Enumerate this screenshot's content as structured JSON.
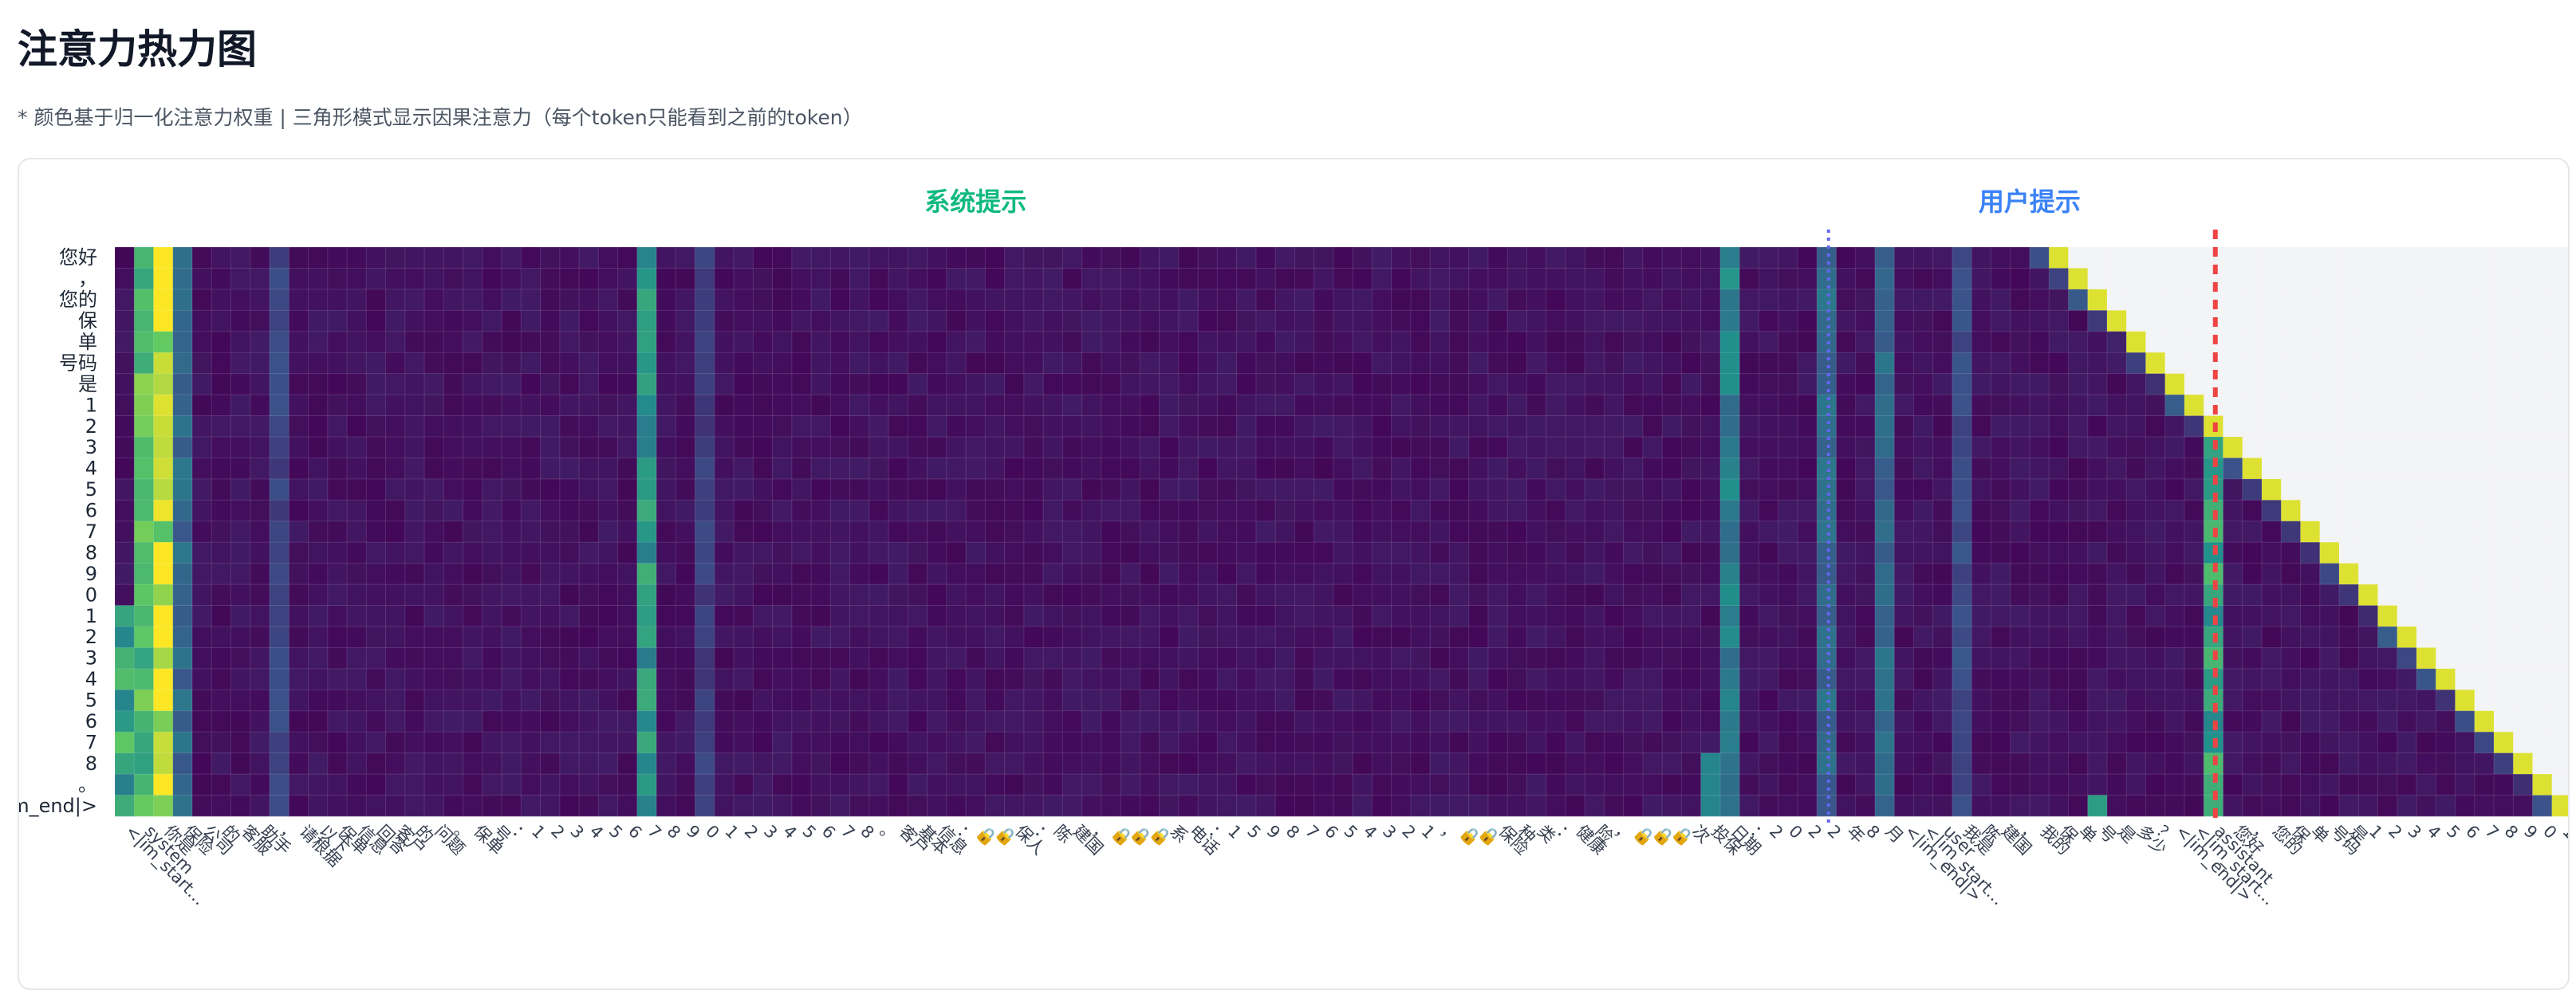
{
  "page": {
    "title": "注意力热力图",
    "note": "* 颜色基于归一化注意力权重 | 三角形模式显示因果注意力（每个token只能看到之前的token）"
  },
  "colors": {
    "system_section": "#10b981",
    "user_section": "#3b82f6",
    "system_divider": "#6366f1",
    "assistant_divider": "#ef4444",
    "masked_cell": "#f3f4f6",
    "colormap": "viridis"
  },
  "chart_data": {
    "type": "heatmap",
    "title": "",
    "xlabel": "",
    "ylabel": "",
    "sections": [
      {
        "name": "系统提示",
        "color": "#10b981",
        "start": 0,
        "end": 88
      },
      {
        "name": "用户提示",
        "color": "#3b82f6",
        "start": 89,
        "end": 108
      }
    ],
    "dividers": [
      {
        "after_index": 88,
        "style": "dotted",
        "color": "#6366f1"
      },
      {
        "after_index": 108,
        "style": "dashed",
        "color": "#ef4444"
      }
    ],
    "x_tokens": [
      "<|im_start…",
      "system",
      "你是",
      "保险",
      "公司",
      "的",
      "客服",
      "助手",
      "，",
      "请根据",
      "以下",
      "保单",
      "信息",
      "回答",
      "客户",
      "的",
      "问题",
      "。",
      "保单",
      "号",
      "：",
      "1",
      "2",
      "3",
      "4",
      "5",
      "6",
      "7",
      "8",
      "9",
      "0",
      "1",
      "2",
      "3",
      "4",
      "5",
      "6",
      "7",
      "8",
      "。",
      "客户",
      "基本",
      "信息",
      "：",
      "🔒",
      "🔒",
      "保人",
      "：",
      "陈",
      "建国",
      "，",
      "🔒",
      "🔒",
      "🔒",
      "系",
      "电话",
      "：",
      "1",
      "5",
      "9",
      "8",
      "7",
      "6",
      "5",
      "4",
      "3",
      "2",
      "1",
      "，",
      "🔒",
      "🔒",
      "保险",
      "种",
      "类",
      "：",
      "健康",
      "险",
      "，",
      "🔒",
      "🔒",
      "🔒",
      "次",
      "投保",
      "日期",
      "：",
      "2",
      "0",
      "2",
      "2",
      "年",
      "8",
      "月",
      "<|im_end|>",
      "<|im_start…",
      "user",
      "我是",
      "陈",
      "建国",
      "，",
      "我的",
      "保",
      "单",
      "号",
      "是",
      "多少",
      "？",
      "<|im_end|>",
      "<|im_start…",
      "assistant",
      "您好",
      "，",
      "您的",
      "保",
      "单",
      "号码",
      "是",
      "1",
      "2",
      "3",
      "4",
      "5",
      "6",
      "7",
      "8",
      "9",
      "0",
      "1"
    ],
    "y_tokens": [
      "您好",
      "，",
      "您的",
      "保",
      "单",
      "号码",
      "是",
      "1",
      "2",
      "3",
      "4",
      "5",
      "6",
      "7",
      "8",
      "9",
      "0",
      "1",
      "2",
      "3",
      "4",
      "5",
      "6",
      "7",
      "8",
      "。",
      "<|im_end|>"
    ],
    "y_tick_display": [
      "您好",
      "，",
      "您的",
      "保",
      "单",
      "号码",
      "是",
      "1",
      "2",
      "3",
      "4",
      "5",
      "6",
      "7",
      "8",
      "9",
      "0",
      "1",
      "2",
      "3",
      "4",
      "5",
      "6",
      "7",
      "8",
      "。",
      "m_end|>"
    ],
    "value_range": [
      0,
      1
    ],
    "causal": true,
    "strong_columns": [
      {
        "index": 1,
        "weight": 0.75
      },
      {
        "index": 2,
        "weight": 0.95
      },
      {
        "index": 3,
        "weight": 0.35
      },
      {
        "index": 8,
        "weight": 0.22
      },
      {
        "index": 27,
        "weight": 0.55
      },
      {
        "index": 30,
        "weight": 0.2
      },
      {
        "index": 83,
        "weight": 0.45
      },
      {
        "index": 88,
        "weight": 0.35
      },
      {
        "index": 91,
        "weight": 0.35
      },
      {
        "index": 95,
        "weight": 0.25
      },
      {
        "index": 108,
        "weight": 0.6
      }
    ],
    "grid": true,
    "legend": "none"
  }
}
